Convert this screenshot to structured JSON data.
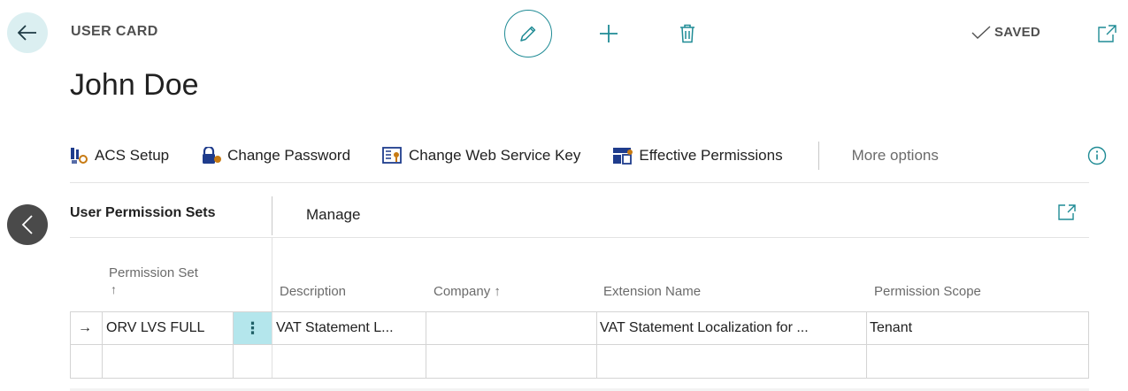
{
  "header": {
    "caption": "USER CARD",
    "title": "John Doe",
    "status": "SAVED",
    "back_icon": "arrow-left-icon",
    "edit_icon": "pencil-icon",
    "new_icon": "plus-icon",
    "delete_icon": "trash-icon",
    "popout_icon": "open-in-new-window-icon"
  },
  "actions": [
    {
      "label": "ACS Setup",
      "icon": "acs-setup-icon"
    },
    {
      "label": "Change Password",
      "icon": "password-lock-icon"
    },
    {
      "label": "Change Web Service Key",
      "icon": "web-service-key-icon"
    },
    {
      "label": "Effective Permissions",
      "icon": "effective-permissions-icon"
    }
  ],
  "more_options": "More options",
  "part": {
    "title": "User Permission Sets",
    "manage": "Manage",
    "columns": {
      "permission_set": "Permission Set",
      "permission_set_sort": "↑",
      "description": "Description",
      "company": "Company ↑",
      "extension_name": "Extension Name",
      "permission_scope": "Permission Scope"
    },
    "rows": [
      {
        "indicator": "→",
        "permission_set": "ORV LVS FULL",
        "menu": "⋮",
        "description": "VAT Statement L...",
        "company": "",
        "extension_name": "VAT Statement Localization for ...",
        "permission_scope": "Tenant"
      },
      {
        "indicator": "",
        "permission_set": "",
        "menu": "",
        "description": "",
        "company": "",
        "extension_name": "",
        "permission_scope": ""
      }
    ]
  },
  "colors": {
    "accent": "#1f8b95",
    "row_highlight": "#b4e6ec",
    "back_circle": "#dbeff1"
  }
}
